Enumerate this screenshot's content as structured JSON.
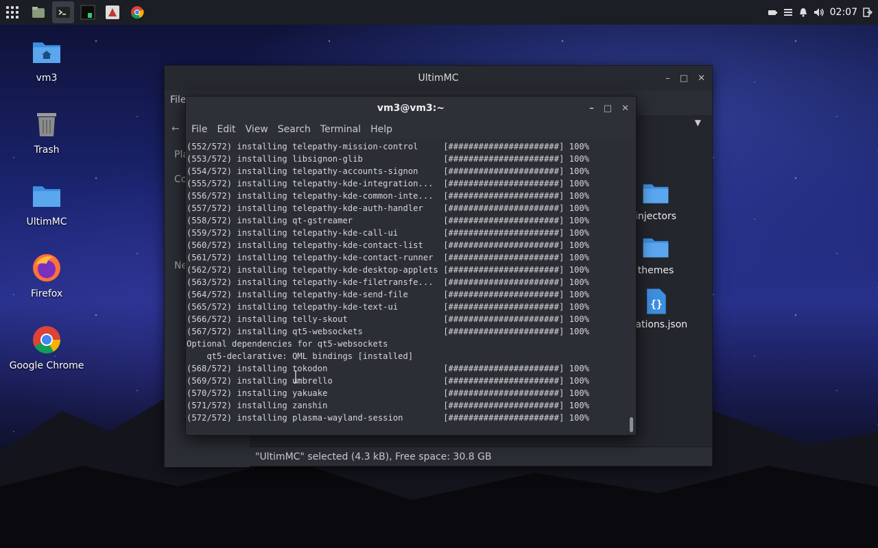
{
  "panel": {
    "clock": "02:07",
    "tasks": [
      "files-app",
      "terminal-app",
      "terminal-app-2",
      "pdf-app",
      "chrome-app"
    ]
  },
  "desktop": {
    "icons": [
      {
        "label": "vm3",
        "icon": "home-folder-icon"
      },
      {
        "label": "Trash",
        "icon": "trash-icon"
      },
      {
        "label": "UltimMC",
        "icon": "folder-icon"
      },
      {
        "label": "Firefox",
        "icon": "firefox-icon"
      },
      {
        "label": "Google Chrome",
        "icon": "chrome-icon"
      }
    ]
  },
  "file_manager": {
    "title": "UltimMC",
    "menu_file": "File",
    "sidebar": {
      "pl": "Pla",
      "co": "Co",
      "ne": "Ne"
    },
    "items": [
      {
        "label": "injectors",
        "icon": "folder-icon"
      },
      {
        "label": "themes",
        "icon": "folder-icon"
      },
      {
        "label": "fications.json",
        "icon": "json-file-icon"
      }
    ],
    "status": "\"UltimMC\" selected (4.3 kB), Free space: 30.8 GB"
  },
  "terminal": {
    "title": "vm3@vm3:~",
    "menu": [
      "File",
      "Edit",
      "View",
      "Search",
      "Terminal",
      "Help"
    ],
    "lines": [
      "(552/572) installing telepathy-mission-control     [######################] 100%",
      "(553/572) installing libsignon-glib                [######################] 100%",
      "(554/572) installing telepathy-accounts-signon     [######################] 100%",
      "(555/572) installing telepathy-kde-integration...  [######################] 100%",
      "(556/572) installing telepathy-kde-common-inte...  [######################] 100%",
      "(557/572) installing telepathy-kde-auth-handler    [######################] 100%",
      "(558/572) installing qt-gstreamer                  [######################] 100%",
      "(559/572) installing telepathy-kde-call-ui         [######################] 100%",
      "(560/572) installing telepathy-kde-contact-list    [######################] 100%",
      "(561/572) installing telepathy-kde-contact-runner  [######################] 100%",
      "(562/572) installing telepathy-kde-desktop-applets [######################] 100%",
      "(563/572) installing telepathy-kde-filetransfe...  [######################] 100%",
      "(564/572) installing telepathy-kde-send-file       [######################] 100%",
      "(565/572) installing telepathy-kde-text-ui         [######################] 100%",
      "(566/572) installing telly-skout                   [######################] 100%",
      "(567/572) installing qt5-websockets                [######################] 100%",
      "Optional dependencies for qt5-websockets",
      "    qt5-declarative: QML bindings [installed]",
      "(568/572) installing tokodon                       [######################] 100%",
      "(569/572) installing umbrello                      [######################] 100%",
      "(570/572) installing yakuake                       [######################] 100%",
      "(571/572) installing zanshin                       [######################] 100%",
      "(572/572) installing plasma-wayland-session        [######################] 100%"
    ]
  }
}
